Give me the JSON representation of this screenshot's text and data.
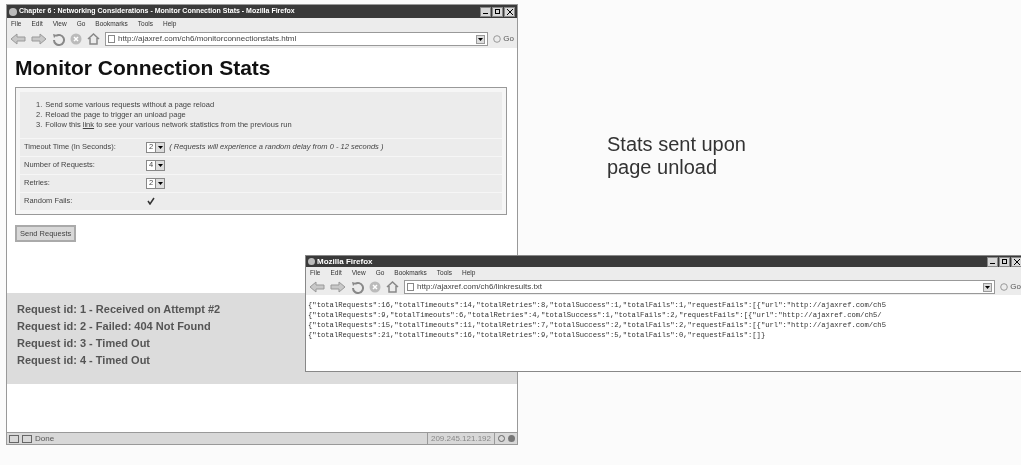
{
  "main_window": {
    "title": "Chapter 6 : Networking Considerations - Monitor Connection Stats - Mozilla Firefox",
    "menu": [
      "File",
      "Edit",
      "View",
      "Go",
      "Bookmarks",
      "Tools",
      "Help"
    ],
    "url": "http://ajaxref.com/ch6/monitorconnectionstats.html",
    "go_label": "Go",
    "heading": "Monitor Connection Stats",
    "steps": [
      {
        "number": "1.",
        "text": "Send some various requests without a page reload"
      },
      {
        "number": "2.",
        "text": "Reload the page to trigger an unload page"
      },
      {
        "number": "3.",
        "text": "Follow this ",
        "link": "link",
        "text_after": " to see your various network statistics from the previous run"
      }
    ],
    "form_rows": [
      {
        "kind": "select",
        "label": "Timeout Time (In Seconds):",
        "value": "2",
        "note": "( Requests will experience a random delay from 0 - 12 seconds )"
      },
      {
        "kind": "select",
        "label": "Number of Requests:",
        "value": "4"
      },
      {
        "kind": "select",
        "label": "Retries:",
        "value": "2"
      },
      {
        "kind": "checkbox",
        "label": "Random Fails:",
        "checked": true
      }
    ],
    "send_button": "Send Requests",
    "results": [
      "Request id: 1 - Received on Attempt #2",
      "Request id: 2 - Failed: 404 Not Found",
      "Request id: 3 - Timed Out",
      "Request id: 4 - Timed Out"
    ],
    "status_text": "Done",
    "status_ip": "209.245.121.192"
  },
  "callout": "Stats sent upon page unload",
  "results_window": {
    "title": "Mozilla Firefox",
    "menu": [
      "File",
      "Edit",
      "View",
      "Go",
      "Bookmarks",
      "Tools",
      "Help"
    ],
    "url": "http://ajaxref.com/ch6/linkresults.txt",
    "go_label": "Go",
    "lines": [
      "{\"totalRequests\":16,\"totalTimeouts\":14,\"totalRetries\":8,\"totalSuccess\":1,\"totalFails\":1,\"requestFails\":[{\"url\":\"http://ajaxref.com/ch5",
      "{\"totalRequests\":9,\"totalTimeouts\":6,\"totalRetries\":4,\"totalSuccess\":1,\"totalFails\":2,\"requestFails\":[{\"url\":\"http://ajaxref.com/ch5/",
      "{\"totalRequests\":15,\"totalTimeouts\":11,\"totalRetries\":7,\"totalSuccess\":2,\"totalFails\":2,\"requestFails\":[{\"url\":\"http://ajaxref.com/ch5",
      "{\"totalRequests\":21,\"totalTimeouts\":16,\"totalRetries\":9,\"totalSuccess\":5,\"totalFails\":0,\"requestFails\":[]}"
    ]
  }
}
